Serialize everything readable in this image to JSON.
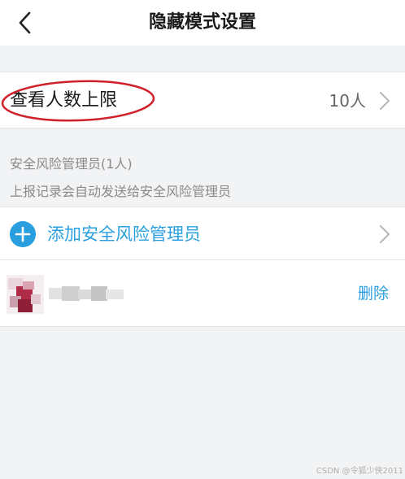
{
  "header": {
    "title": "隐藏模式设置",
    "back_icon": "chevron-left-icon"
  },
  "view_limit": {
    "label": "查看人数上限",
    "value": "10人",
    "annotation_color": "#d0202a"
  },
  "admins": {
    "title": "安全风险管理员(1人)",
    "description": "上报记录会自动发送给安全风险管理员",
    "add_label": "添加安全风险管理员",
    "members": [
      {
        "delete_label": "删除"
      }
    ]
  },
  "colors": {
    "accent": "#2a9fe0",
    "background": "#f2f3f5"
  },
  "watermark": "CSDN @令狐少侠2011"
}
